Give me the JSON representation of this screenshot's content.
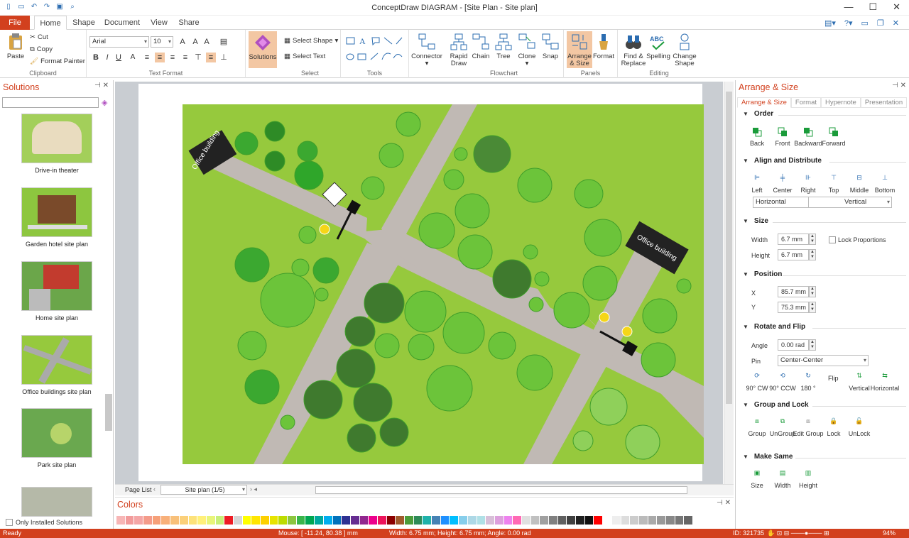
{
  "window": {
    "title": "ConceptDraw DIAGRAM - [Site Plan - Site plan]"
  },
  "tabs": [
    "File",
    "Home",
    "Shape",
    "Document",
    "View",
    "Share"
  ],
  "ribbon": {
    "clipboard": {
      "paste": "Paste",
      "cut": "Cut",
      "copy": "Copy",
      "format_painter": "Format Painter",
      "label": "Clipboard"
    },
    "text_format": {
      "font": "Arial",
      "size": "10",
      "label": "Text Format"
    },
    "solutions": "Solutions",
    "select": {
      "select_shape": "Select Shape",
      "select_text": "Select Text",
      "label": "Select"
    },
    "tools": {
      "label": "Tools"
    },
    "connector": "Connector",
    "flowchart": {
      "rapid_draw": "Rapid Draw",
      "chain": "Chain",
      "tree": "Tree",
      "clone": "Clone",
      "snap": "Snap",
      "label": "Flowchart"
    },
    "panels": {
      "arrange_size": "Arrange & Size",
      "format": "Format",
      "label": "Panels"
    },
    "editing": {
      "find_replace": "Find & Replace",
      "spelling": "Spelling",
      "change_shape": "Change Shape",
      "label": "Editing"
    }
  },
  "solutions_panel": {
    "title": "Solutions",
    "items": [
      "Drive-in theater",
      "Garden hotel site plan",
      "Home site plan",
      "Office buildings site plan",
      "Park site plan"
    ],
    "only_installed": "Only Installed Solutions"
  },
  "canvas": {
    "labels": [
      "Office building",
      "Office building"
    ],
    "page_list": "Page List",
    "page_select": "Site plan (1/5)"
  },
  "colors_panel": {
    "title": "Colors",
    "swatches": [
      "#f7b6b6",
      "#f29b9b",
      "#f4a6a6",
      "#f49b8a",
      "#f6a079",
      "#f8b07a",
      "#f8c07a",
      "#fbd07a",
      "#fde27a",
      "#fff07a",
      "#e8f57a",
      "#c8ef7a",
      "#ee1c24",
      "#d6d6d6",
      "#ffff00",
      "#ffe600",
      "#fdd000",
      "#e7e400",
      "#bddc00",
      "#8cc63f",
      "#39b54a",
      "#00a651",
      "#00a99d",
      "#00aeef",
      "#0072bc",
      "#2e3192",
      "#662d91",
      "#92278f",
      "#ec008c",
      "#ed145b",
      "#8b0000",
      "#a05a2c",
      "#4b9c3a",
      "#2e8b57",
      "#20b2aa",
      "#4682b4",
      "#1e90ff",
      "#00bfff",
      "#87ceeb",
      "#add8e6",
      "#b0e0e6",
      "#d8bfd8",
      "#dda0dd",
      "#ee82ee",
      "#ff69b4",
      "#e0e0e0",
      "#c0c0c0",
      "#a0a0a0",
      "#808080",
      "#606060",
      "#404040",
      "#202020",
      "#101010",
      "#ff0000",
      "#ffffff",
      "#eeeeee",
      "#dddddd",
      "#cccccc",
      "#bbbbbb",
      "#aaaaaa",
      "#999999",
      "#888888",
      "#777777",
      "#666666"
    ]
  },
  "arrange_panel": {
    "title": "Arrange & Size",
    "tabs": [
      "Arrange & Size",
      "Format",
      "Hypernote",
      "Presentation"
    ],
    "order": {
      "title": "Order",
      "items": [
        "Back",
        "Front",
        "Backward",
        "Forward"
      ]
    },
    "align": {
      "title": "Align and Distribute",
      "items": [
        "Left",
        "Center",
        "Right",
        "Top",
        "Middle",
        "Bottom"
      ],
      "horizontal": "Horizontal",
      "vertical": "Vertical"
    },
    "size": {
      "title": "Size",
      "width_label": "Width",
      "width": "6.7 mm",
      "height_label": "Height",
      "height": "6.7 mm",
      "lock": "Lock Proportions"
    },
    "position": {
      "title": "Position",
      "x_label": "X",
      "x": "85.7 mm",
      "y_label": "Y",
      "y": "75.3 mm"
    },
    "rotate": {
      "title": "Rotate and Flip",
      "angle_label": "Angle",
      "angle": "0.00 rad",
      "pin_label": "Pin",
      "pin": "Center-Center",
      "items": [
        "90° CW",
        "90° CCW",
        "180 °",
        "Flip",
        "Vertical",
        "Horizontal"
      ]
    },
    "group": {
      "title": "Group and Lock",
      "items": [
        "Group",
        "UnGroup",
        "Edit Group",
        "Lock",
        "UnLock"
      ]
    },
    "make_same": {
      "title": "Make Same",
      "items": [
        "Size",
        "Width",
        "Height"
      ]
    }
  },
  "status": {
    "ready": "Ready",
    "mouse": "Mouse: [ -11.24, 80.38 ] mm",
    "size": "Width: 6.75 mm;  Height: 6.75 mm;  Angle: 0.00 rad",
    "id": "ID: 321735",
    "zoom": "94%"
  }
}
